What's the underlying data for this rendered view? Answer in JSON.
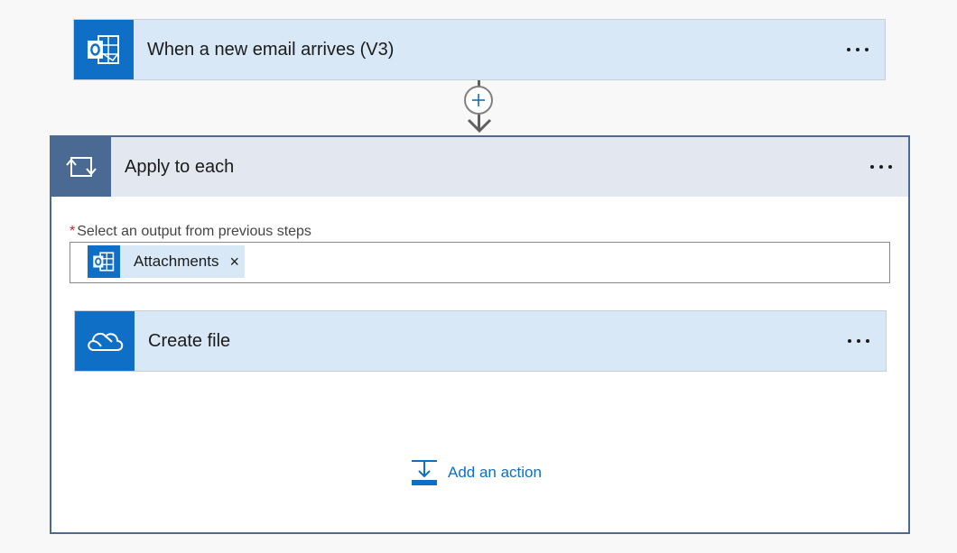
{
  "trigger": {
    "title": "When a new email arrives (V3)",
    "icon": "outlook-icon"
  },
  "insert_step": {
    "icon": "plus-icon"
  },
  "apply_to_each": {
    "title": "Apply to each",
    "icon": "loop-icon",
    "field": {
      "required_marker": "*",
      "label": "Select an output from previous steps",
      "token": {
        "label": "Attachments",
        "remove": "×",
        "icon": "outlook-icon"
      }
    },
    "inner_action": {
      "title": "Create file",
      "icon": "onedrive-icon"
    },
    "add_action": {
      "label": "Add an action",
      "icon": "add-action-icon"
    }
  },
  "colors": {
    "action_icon_bg": "#0f6fc6",
    "action_card_bg": "#d9e8f6",
    "loop_accent": "#4a6a93",
    "loop_header_bg": "#e3e7ef",
    "link": "#0f6fc6",
    "required": "#c4262e"
  }
}
